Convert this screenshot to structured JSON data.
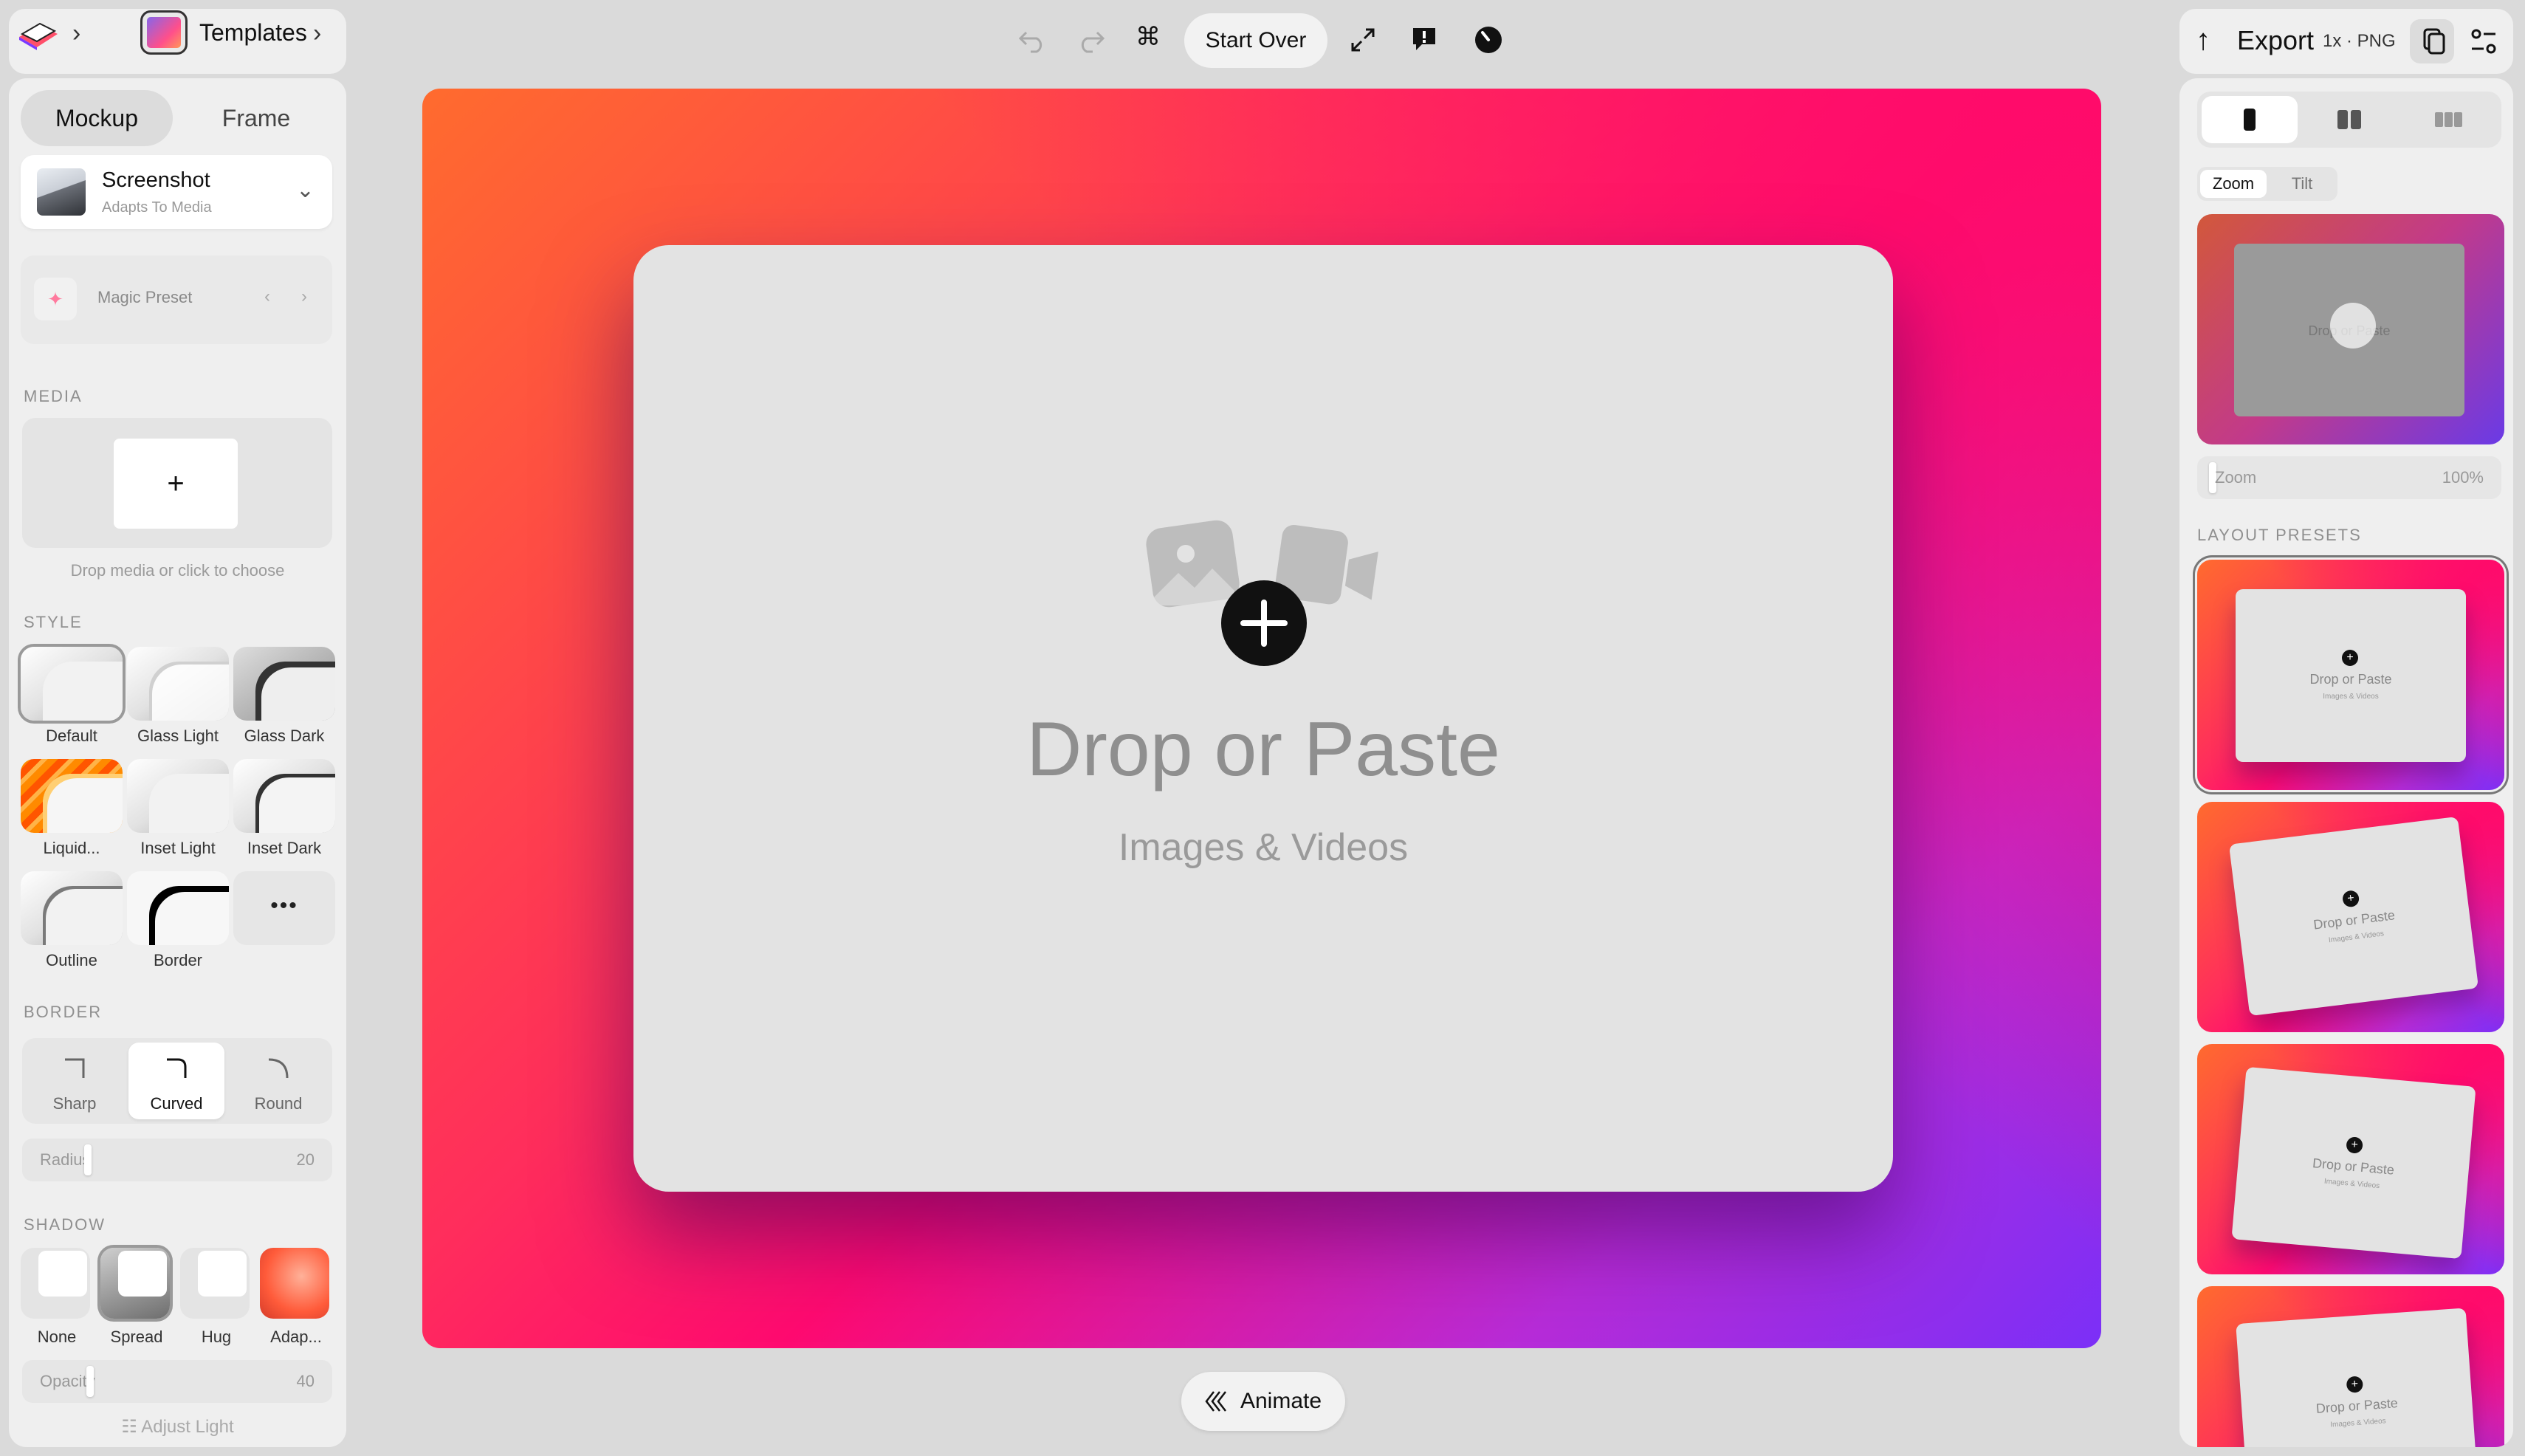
{
  "topbar": {
    "templates_label": "Templates",
    "start_over_label": "Start Over",
    "animate_label": "Animate"
  },
  "left_panel": {
    "tabs": [
      {
        "label": "Mockup",
        "active": true
      },
      {
        "label": "Frame",
        "active": false
      }
    ],
    "device": {
      "title": "Screenshot",
      "subtitle": "Adapts To Media"
    },
    "magic_preset_label": "Magic Preset",
    "media": {
      "section": "MEDIA",
      "add_symbol": "+",
      "help": "Drop media or click to choose"
    },
    "style": {
      "section": "STYLE",
      "items": [
        {
          "label": "Default",
          "selected": true
        },
        {
          "label": "Glass Light"
        },
        {
          "label": "Glass Dark"
        },
        {
          "label": "Liquid..."
        },
        {
          "label": "Inset Light"
        },
        {
          "label": "Inset Dark"
        },
        {
          "label": "Outline"
        },
        {
          "label": "Border"
        }
      ],
      "more_symbol": "•••"
    },
    "border": {
      "section": "BORDER",
      "options": [
        {
          "label": "Sharp"
        },
        {
          "label": "Curved",
          "active": true
        },
        {
          "label": "Round"
        }
      ],
      "radius_label": "Radius",
      "radius_value": "20",
      "radius_fraction": 0.2
    },
    "shadow": {
      "section": "SHADOW",
      "items": [
        {
          "label": "None"
        },
        {
          "label": "Spread",
          "selected": true
        },
        {
          "label": "Hug"
        },
        {
          "label": "Adap..."
        }
      ],
      "opacity_label": "Opacity",
      "opacity_value": "40",
      "opacity_fraction": 0.4
    },
    "adjust_light_label": "Adjust Light"
  },
  "canvas": {
    "title": "Drop or Paste",
    "subtitle": "Images & Videos"
  },
  "right_panel": {
    "export": {
      "label": "Export",
      "meta": "1x · PNG"
    },
    "view_tabs": [
      {
        "label": "Zoom",
        "active": true
      },
      {
        "label": "Tilt",
        "active": false
      }
    ],
    "preview_text": "Drop or Paste",
    "zoom_label": "Zoom",
    "zoom_value": "100%",
    "layout_presets_section": "LAYOUT PRESETS",
    "presets": [
      {
        "title": "Drop or Paste",
        "subtitle": "Images & Videos",
        "selected": true
      },
      {
        "title": "Drop or Paste",
        "subtitle": "Images & Videos"
      },
      {
        "title": "Drop or Paste",
        "subtitle": "Images & Videos"
      },
      {
        "title": "Drop or Paste",
        "subtitle": "Images & Videos"
      }
    ]
  },
  "colors": {
    "gradient_start": "#ff6b2e",
    "gradient_mid": "#ff0a70",
    "gradient_end": "#7b2ff7",
    "panel_bg": "#efefef",
    "app_bg": "#dadada"
  }
}
